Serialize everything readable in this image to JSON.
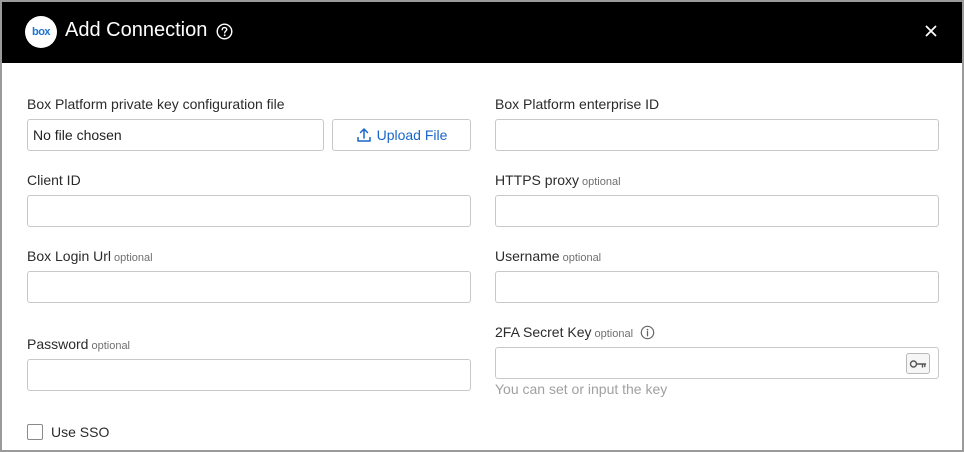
{
  "header": {
    "logo_text": "box",
    "title": "Add Connection",
    "help_icon": "help-circle-icon",
    "close_icon": "close-icon"
  },
  "form": {
    "private_key": {
      "label": "Box Platform private key configuration file",
      "file_status": "No file chosen",
      "upload_label": "Upload File",
      "upload_icon": "upload-icon"
    },
    "enterprise_id": {
      "label": "Box Platform enterprise ID",
      "value": ""
    },
    "client_id": {
      "label": "Client ID",
      "value": ""
    },
    "https_proxy": {
      "label": "HTTPS proxy",
      "optional": "optional",
      "value": ""
    },
    "login_url": {
      "label": "Box Login Url",
      "optional": "optional",
      "value": ""
    },
    "username": {
      "label": "Username",
      "optional": "optional",
      "value": ""
    },
    "password": {
      "label": "Password",
      "optional": "optional",
      "value": ""
    },
    "twofa": {
      "label": "2FA Secret Key",
      "optional": "optional",
      "info_icon": "info-icon",
      "key_icon": "key-icon",
      "value": "",
      "hint": "You can set or input the key"
    },
    "use_sso": {
      "label": "Use SSO",
      "checked": false
    }
  },
  "colors": {
    "header_bg": "#000000",
    "accent": "#1a66c8",
    "border": "#c8c8c8"
  }
}
